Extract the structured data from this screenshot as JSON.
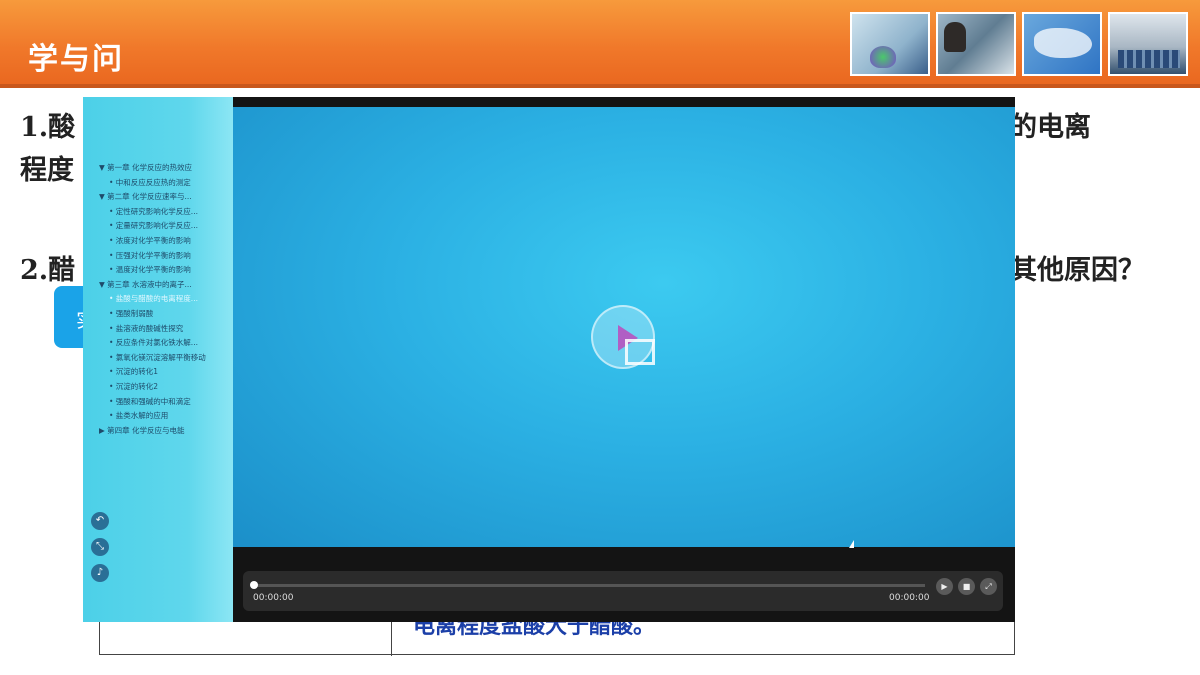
{
  "slide": {
    "title": "学与问",
    "q1_start": "1.酸",
    "q1_line2": "程度",
    "q1_end": "的电离",
    "q2_start": "2.醋",
    "q2_end": "其他原因？",
    "button_char": "实",
    "table_visible_text": "电离程度盐酸大于醋酸。"
  },
  "player": {
    "toc": [
      {
        "label": "▼ 第一章 化学反应的热效应",
        "level": "chapter"
      },
      {
        "label": "• 中和反应反应热的测定",
        "level": "sub"
      },
      {
        "label": "▼ 第二章 化学反应速率与...",
        "level": "chapter"
      },
      {
        "label": "• 定性研究影响化学反应...",
        "level": "sub"
      },
      {
        "label": "• 定量研究影响化学反应...",
        "level": "sub"
      },
      {
        "label": "• 浓度对化学平衡的影响",
        "level": "sub"
      },
      {
        "label": "• 压强对化学平衡的影响",
        "level": "sub"
      },
      {
        "label": "• 温度对化学平衡的影响",
        "level": "sub"
      },
      {
        "label": "▼ 第三章 水溶液中的离子...",
        "level": "chapter"
      },
      {
        "label": "• 盐酸与醋酸的电离程度...",
        "level": "sub",
        "active": true
      },
      {
        "label": "• 强酸制弱酸",
        "level": "sub"
      },
      {
        "label": "• 盐溶液的酸碱性探究",
        "level": "sub"
      },
      {
        "label": "• 反应条件对氯化铁水解...",
        "level": "sub"
      },
      {
        "label": "• 氯氧化镁沉淀溶解平衡移动",
        "level": "sub"
      },
      {
        "label": "• 沉淀的转化1",
        "level": "sub"
      },
      {
        "label": "• 沉淀的转化2",
        "level": "sub"
      },
      {
        "label": "• 强酸和强碱的中和滴定",
        "level": "sub"
      },
      {
        "label": "• 盐类水解的应用",
        "level": "sub"
      },
      {
        "label": "▶ 第四章 化学反应与电能",
        "level": "chapter"
      }
    ],
    "side_icons": [
      "back-icon",
      "shrink-icon",
      "volume-icon"
    ],
    "progress": 0,
    "current_time": "00:00:00",
    "duration": "00:00:00",
    "controls": [
      "play-icon",
      "stop-icon",
      "fullscreen-icon"
    ]
  }
}
